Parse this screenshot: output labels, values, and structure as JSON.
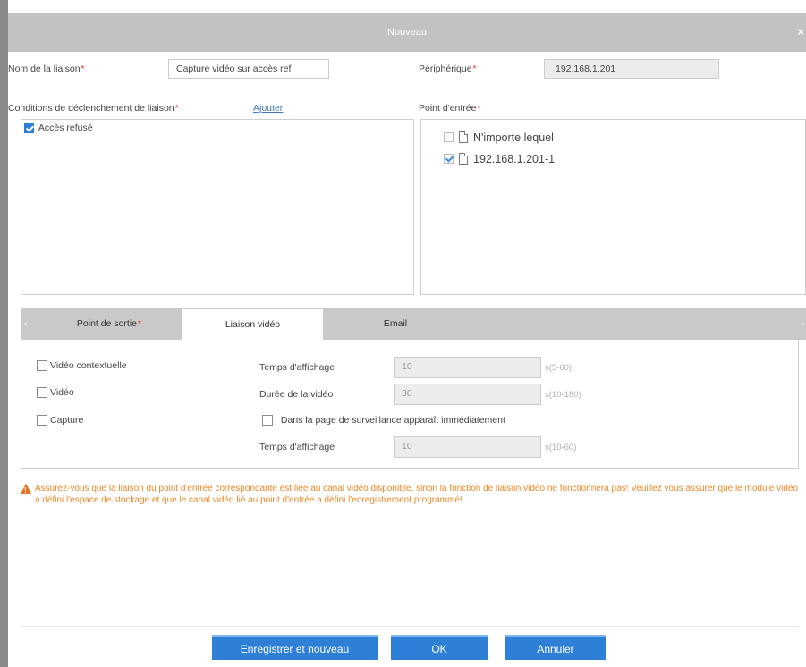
{
  "dialog": {
    "title": "Nouveau",
    "close": "×"
  },
  "form": {
    "link_name_label": "Nom de la liaison",
    "link_name_value": "Capture vidéo sur accès ref",
    "device_label": "Périphérique",
    "device_value": "192.168.1.201"
  },
  "triggers": {
    "label": "Conditions de déclenchement de liaison",
    "add_link": "Ajouter",
    "items": [
      {
        "label": "Accès refusé",
        "checked": true
      }
    ]
  },
  "input_point": {
    "label": "Point d'entrée",
    "items": [
      {
        "label": "N'importe lequel",
        "checked": false
      },
      {
        "label": "192.168.1.201-1",
        "checked": true
      }
    ]
  },
  "tabs": [
    {
      "label": "Point de sortie",
      "required": true,
      "active": false
    },
    {
      "label": "Liaison vidéo",
      "required": false,
      "active": true
    },
    {
      "label": "Email",
      "required": false,
      "active": false
    }
  ],
  "video": {
    "popup_video": "Vidéo contextuelle",
    "video": "Vidéo",
    "capture": "Capture",
    "display_time_label": "Temps d'affichage",
    "display_time_value": "10",
    "display_time_unit": "s(5-60)",
    "video_duration_label": "Durée de la vidéo",
    "video_duration_value": "30",
    "video_duration_unit": "s(10-180)",
    "monitor_page_label": "Dans la page de surveillance apparaît immédiatement",
    "capture_display_time_label": "Temps d'affichage",
    "capture_display_time_value": "10",
    "capture_display_time_unit": "s(10-60)"
  },
  "warning": "Assurez-vous que la liaison du point d'entrée correspondante est liée au canal vidéo disponible, sinon la fonction de liaison vidéo ne fonctionnera pas! Veuillez vous assurer que le module vidéo a défini l'espace de stockage et que le canal vidéo lié au point d'entrée a défini l'enregistrement programmé!",
  "buttons": {
    "save_new": "Enregistrer et nouveau",
    "ok": "OK",
    "cancel": "Annuler"
  },
  "colors": {
    "primary": "#2e7fd6",
    "warning": "#e8892a",
    "titlebar": "#c2c2c2"
  }
}
